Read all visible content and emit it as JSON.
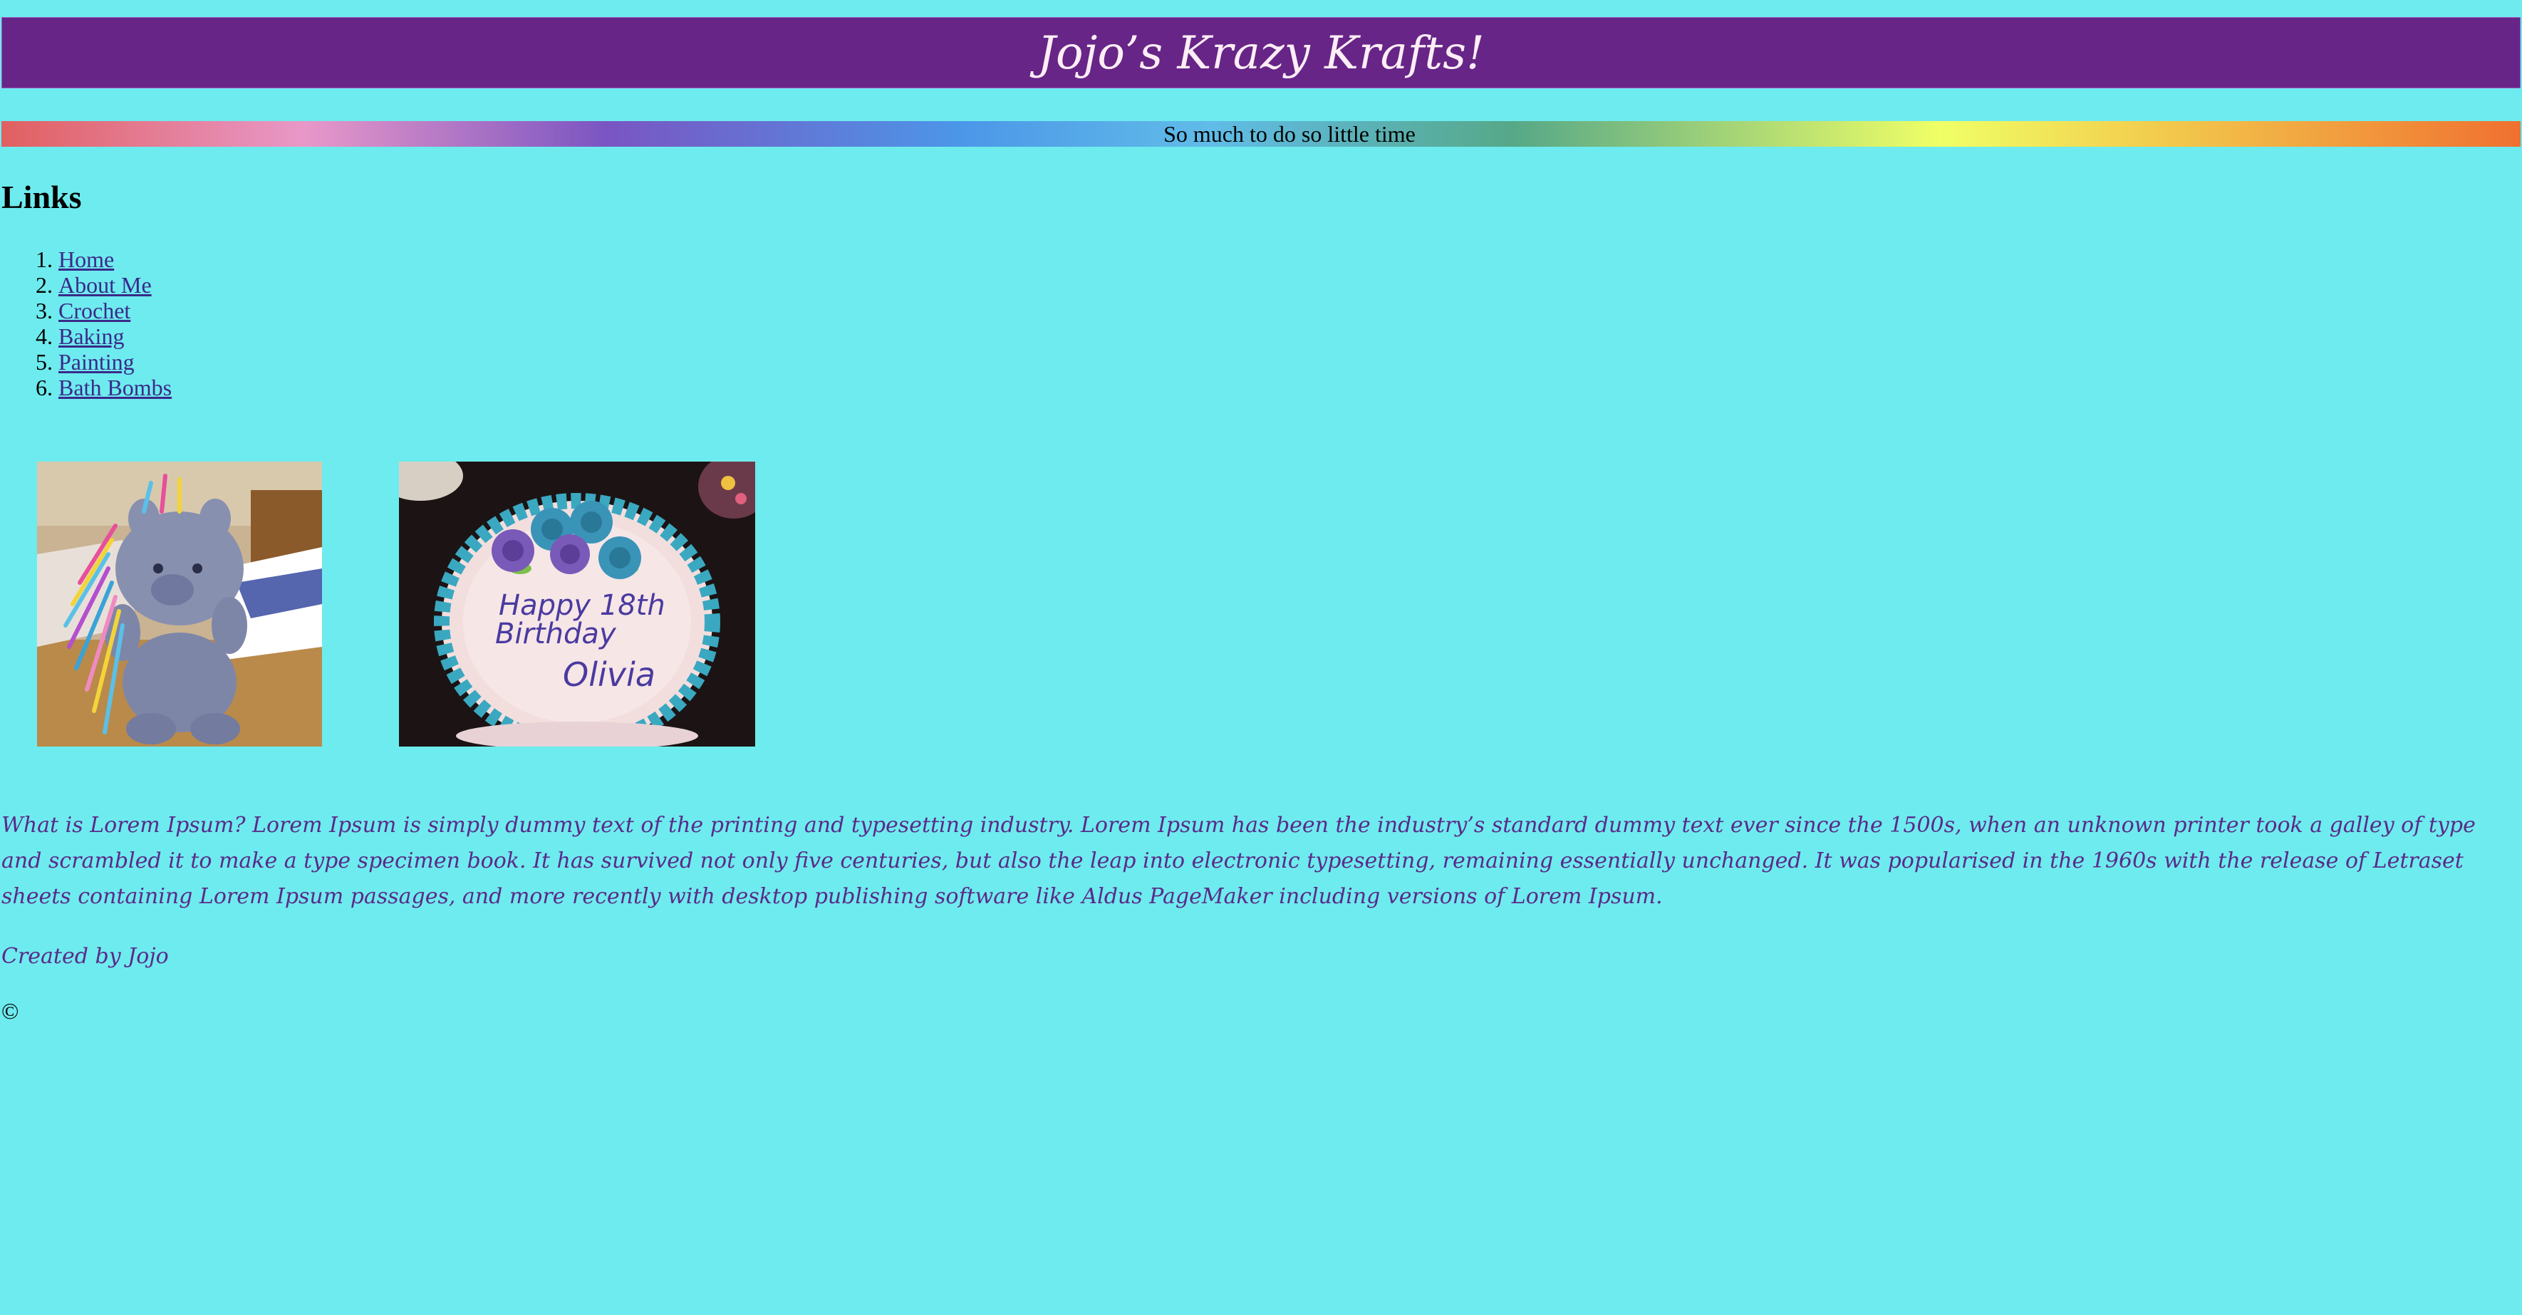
{
  "header": {
    "title": "Jojo’s Krazy Krafts!",
    "background_color": "#672587",
    "title_color": "#ffeef5"
  },
  "banner": {
    "tagline": "So much to do so little time"
  },
  "links": {
    "heading": "Links",
    "items": [
      {
        "label": "Home"
      },
      {
        "label": "About Me"
      },
      {
        "label": "Crochet"
      },
      {
        "label": "Baking"
      },
      {
        "label": "Painting"
      },
      {
        "label": "Bath Bombs"
      }
    ]
  },
  "gallery": {
    "cake_text_line1": "Happy 18th",
    "cake_text_line2": "Birthday",
    "cake_text_line3": "Olivia"
  },
  "content": {
    "paragraph": "What is Lorem Ipsum? Lorem Ipsum is simply dummy text of the printing and typesetting industry. Lorem Ipsum has been the industry’s standard dummy text ever since the 1500s, when an unknown printer took a galley of type and scrambled it to make a type specimen book. It has survived not only five centuries, but also the leap into electronic typesetting, remaining essentially unchanged. It was popularised in the 1960s with the release of Letraset sheets containing Lorem Ipsum passages, and more recently with desktop publishing software like Aldus PageMaker including versions of Lorem Ipsum."
  },
  "footer": {
    "credit": "Created by Jojo",
    "copyright": "©"
  },
  "colors": {
    "page_background": "#6eebee",
    "link": "#3a2a8a",
    "body_text": "#5a2a8a"
  }
}
